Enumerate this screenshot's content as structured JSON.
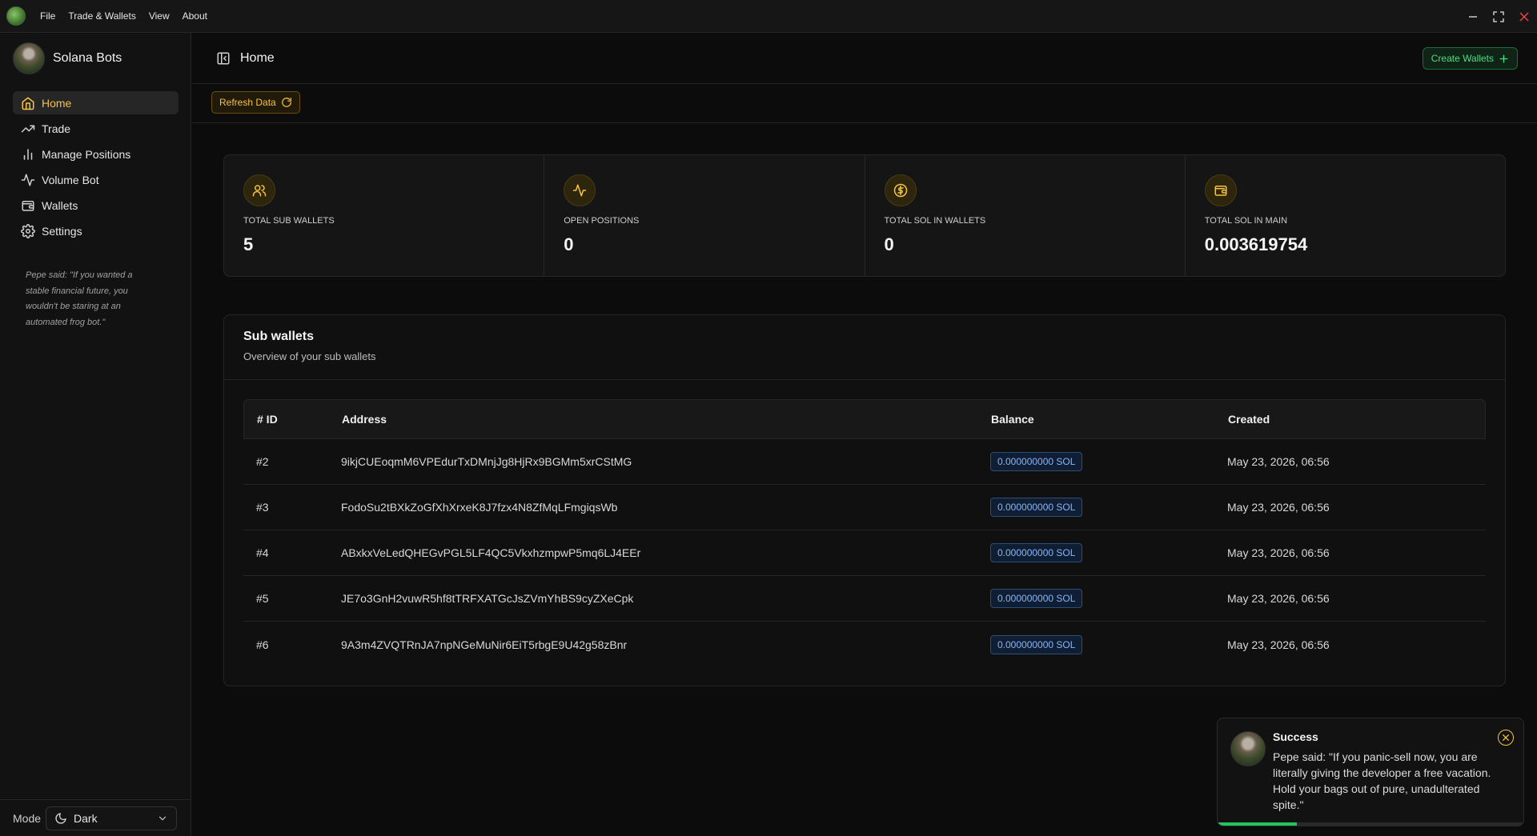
{
  "menubar": {
    "items": [
      "File",
      "Trade & Wallets",
      "View",
      "About"
    ]
  },
  "sidebar": {
    "brand": "Solana Bots",
    "items": [
      {
        "label": "Home",
        "icon": "home-icon",
        "active": true
      },
      {
        "label": "Trade",
        "icon": "trending-up-icon",
        "active": false
      },
      {
        "label": "Manage Positions",
        "icon": "bar-chart-icon",
        "active": false
      },
      {
        "label": "Volume Bot",
        "icon": "activity-icon",
        "active": false
      },
      {
        "label": "Wallets",
        "icon": "wallet-icon",
        "active": false
      },
      {
        "label": "Settings",
        "icon": "gear-icon",
        "active": false
      }
    ],
    "quote": "Pepe said: \"If you wanted a stable financial future, you wouldn't be staring at an automated frog bot.\"",
    "mode_label": "Mode",
    "mode_value": "Dark"
  },
  "header": {
    "title": "Home",
    "create_label": "Create Wallets"
  },
  "toolbar": {
    "refresh_label": "Refresh Data"
  },
  "stats": [
    {
      "label": "Total Sub Wallets",
      "value": "5",
      "icon": "users-icon"
    },
    {
      "label": "Open Positions",
      "value": "0",
      "icon": "activity-icon"
    },
    {
      "label": "Total SOL in Wallets",
      "value": "0",
      "icon": "dollar-circle-icon"
    },
    {
      "label": "Total SOL in Main",
      "value": "0.003619754",
      "icon": "wallet-icon"
    }
  ],
  "subwallets": {
    "title": "Sub wallets",
    "subtitle": "Overview of your sub wallets",
    "columns": [
      "# ID",
      "Address",
      "Balance",
      "Created"
    ],
    "rows": [
      {
        "id": "#2",
        "address": "9ikjCUEoqmM6VPEdurTxDMnjJg8HjRx9BGMm5xrCStMG",
        "balance": "0.000000000 SOL",
        "created": "May 23, 2026, 06:56"
      },
      {
        "id": "#3",
        "address": "FodoSu2tBXkZoGfXhXrxeK8J7fzx4N8ZfMqLFmgiqsWb",
        "balance": "0.000000000 SOL",
        "created": "May 23, 2026, 06:56"
      },
      {
        "id": "#4",
        "address": "ABxkxVeLedQHEGvPGL5LF4QC5VkxhzmpwP5mq6LJ4EEr",
        "balance": "0.000000000 SOL",
        "created": "May 23, 2026, 06:56"
      },
      {
        "id": "#5",
        "address": "JE7o3GnH2vuwR5hf8tTRFXATGcJsZVmYhBS9cyZXeCpk",
        "balance": "0.000000000 SOL",
        "created": "May 23, 2026, 06:56"
      },
      {
        "id": "#6",
        "address": "9A3m4ZVQTRnJA7npNGeMuNir6EiT5rbgE9U42g58zBnr",
        "balance": "0.000000000 SOL",
        "created": "May 23, 2026, 06:56"
      }
    ]
  },
  "toast": {
    "title": "Success",
    "message": "Pepe said: \"If you panic-sell now, you are literally giving the developer a free vacation. Hold your bags out of pure, unadulterated spite.\"",
    "progress": 0.26
  },
  "colors": {
    "accent": "#f5c242",
    "success": "#22c55e",
    "info": "#8ab4f8"
  }
}
